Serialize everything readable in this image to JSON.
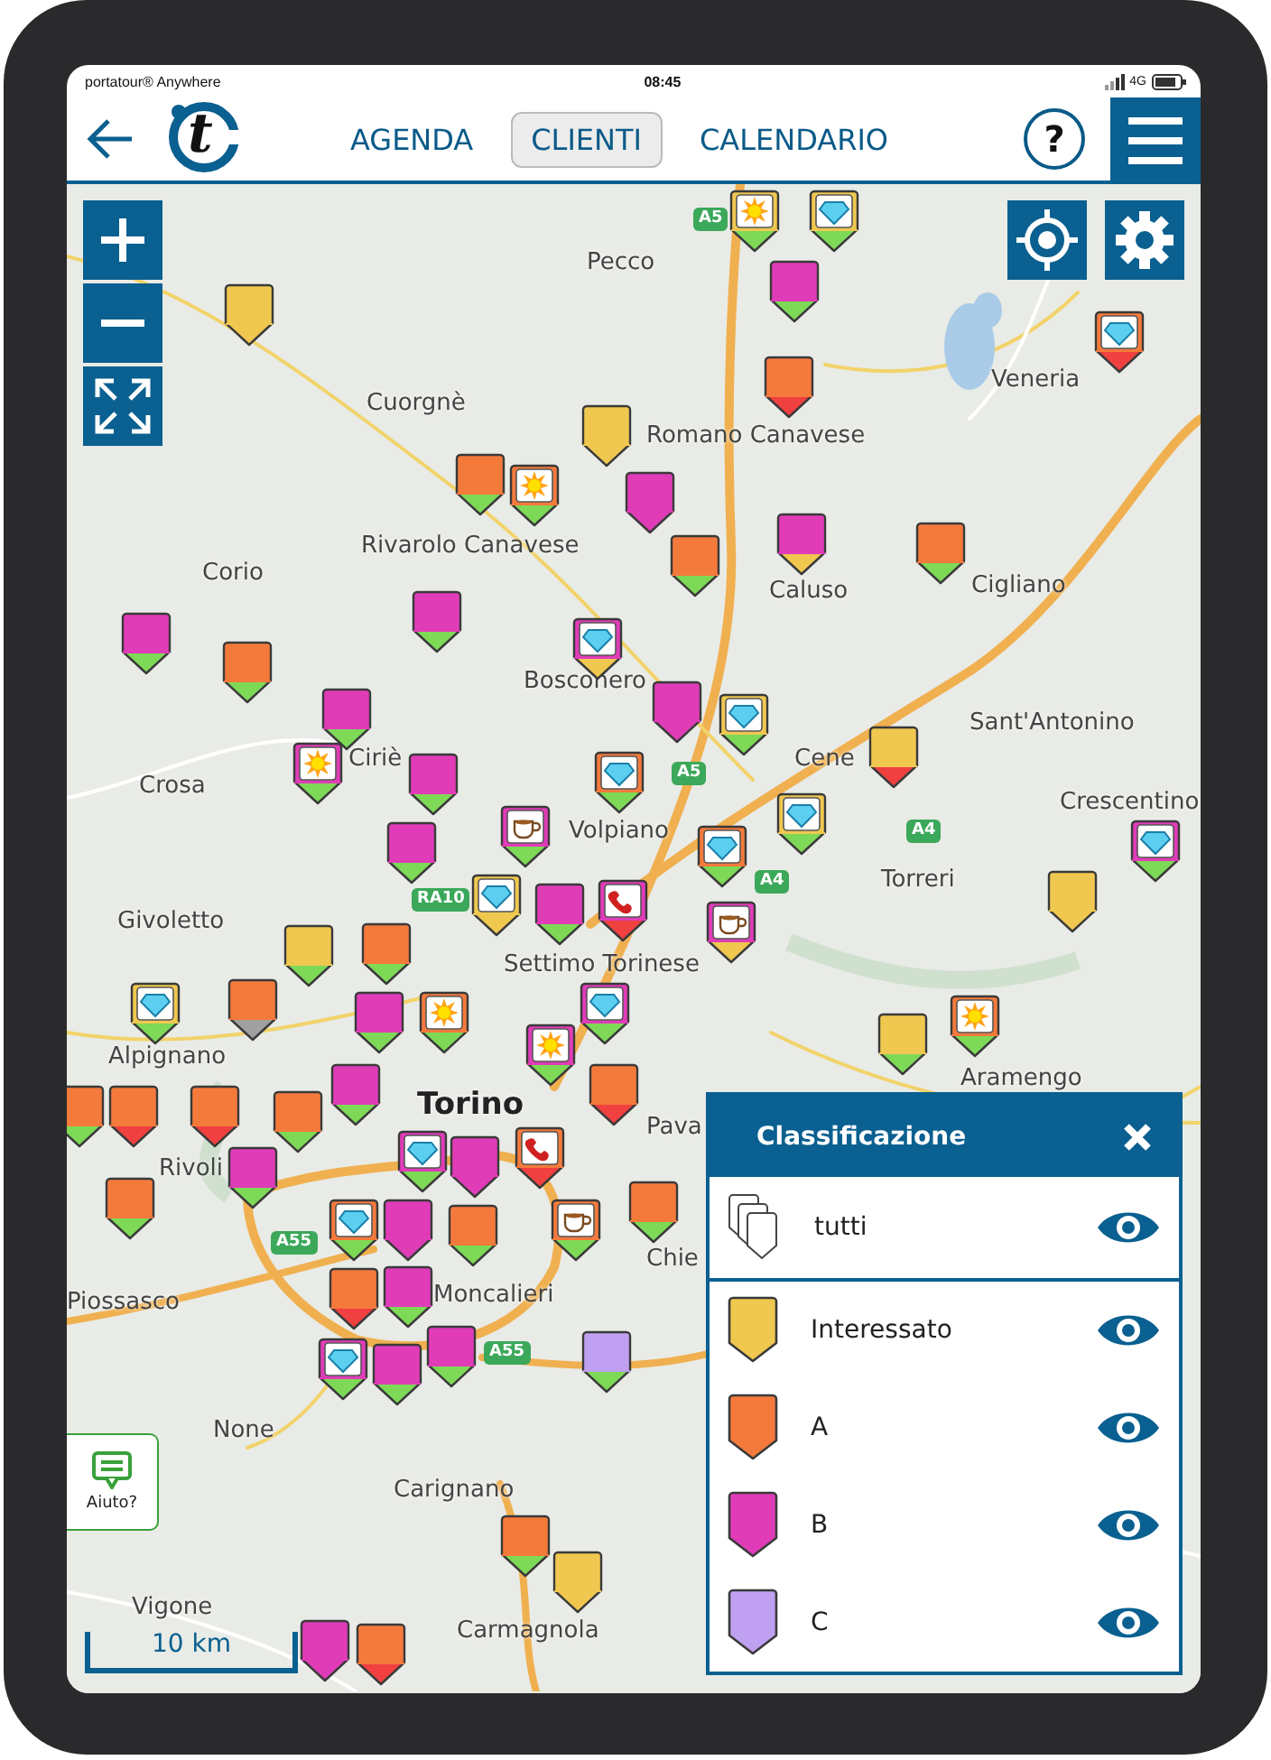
{
  "status_bar": {
    "app": "portatour® Anywhere",
    "time": "08:45",
    "network": "4G"
  },
  "header": {
    "logo_letter": "t",
    "tabs": [
      {
        "label": "AGENDA",
        "selected": false
      },
      {
        "label": "CLIENTI",
        "selected": true
      },
      {
        "label": "CALENDARIO",
        "selected": false
      }
    ],
    "help": "?"
  },
  "map": {
    "places": [
      {
        "name": "Pecco"
      },
      {
        "name": "Cuorgnè"
      },
      {
        "name": "Romano Canavese"
      },
      {
        "name": "Veneria"
      },
      {
        "name": "Rivarolo Canavese"
      },
      {
        "name": "Corio"
      },
      {
        "name": "Caluso"
      },
      {
        "name": "Cigliano"
      },
      {
        "name": "Bosconero"
      },
      {
        "name": "Sant'Antonino"
      },
      {
        "name": "Ciriè"
      },
      {
        "name": "Crosa"
      },
      {
        "name": "Cene"
      },
      {
        "name": "Volpiano"
      },
      {
        "name": "Crescentino"
      },
      {
        "name": "Givoletto"
      },
      {
        "name": "Torreri"
      },
      {
        "name": "Settimo Torinese"
      },
      {
        "name": "Alpignano"
      },
      {
        "name": "Torino",
        "kind": "city"
      },
      {
        "name": "Rivoli"
      },
      {
        "name": "Aramengo"
      },
      {
        "name": "Pava"
      },
      {
        "name": "Chie"
      },
      {
        "name": "Moncalieri"
      },
      {
        "name": "Piossasco"
      },
      {
        "name": "None"
      },
      {
        "name": "Carignano"
      },
      {
        "name": "Vigone"
      },
      {
        "name": "Carmagnola"
      }
    ],
    "roads": [
      {
        "label": "A5"
      },
      {
        "label": "A5"
      },
      {
        "label": "A4"
      },
      {
        "label": "A4"
      },
      {
        "label": "RA10"
      },
      {
        "label": "A55"
      },
      {
        "label": "A55"
      }
    ],
    "markers": [
      {
        "kind": "plain",
        "color": "#f0c850",
        "tail": {
          "color": "#f0c850"
        }
      },
      {
        "kind": "plain",
        "color": "#e03cb8",
        "tail": {
          "color": "#7ed957"
        }
      },
      {
        "kind": "sun",
        "color": "#f0c850",
        "tail": {
          "color": "#7ed957"
        }
      },
      {
        "kind": "diamond",
        "color": "#f0c850",
        "tail": {
          "color": "#7ed957"
        }
      },
      {
        "kind": "diamond",
        "color": "#f47a3c",
        "tail": {
          "color": "#f04040"
        }
      },
      {
        "kind": "plain",
        "color": "#f47a3c",
        "tail": {
          "color": "#f04040"
        }
      },
      {
        "kind": "plain",
        "color": "#f0c850",
        "tail": {
          "color": "#f0c850"
        }
      },
      {
        "kind": "plain",
        "color": "#f47a3c",
        "tail": {
          "color": "#7ed957"
        }
      },
      {
        "kind": "sun",
        "color": "#f47a3c",
        "tail": {
          "color": "#7ed957"
        }
      },
      {
        "kind": "plain",
        "color": "#e03cb8",
        "tail": {
          "color": "#e03cb8"
        }
      },
      {
        "kind": "plain",
        "color": "#f47a3c",
        "tail": {
          "color": "#7ed957"
        }
      },
      {
        "kind": "plain",
        "color": "#e03cb8",
        "tail": {
          "color": "#f0c850"
        }
      },
      {
        "kind": "plain",
        "color": "#f47a3c",
        "tail": {
          "color": "#7ed957"
        }
      },
      {
        "kind": "plain",
        "color": "#e03cb8",
        "tail": {
          "color": "#7ed957"
        }
      },
      {
        "kind": "plain",
        "color": "#e03cb8",
        "tail": {
          "color": "#7ed957"
        }
      },
      {
        "kind": "plain",
        "color": "#f47a3c",
        "tail": {
          "color": "#7ed957"
        }
      },
      {
        "kind": "diamond",
        "color": "#e03cb8",
        "tail": {
          "color": "#f0c850"
        }
      },
      {
        "kind": "plain",
        "color": "#e03cb8",
        "tail": {
          "color": "#7ed957"
        }
      },
      {
        "kind": "sun",
        "color": "#e03cb8",
        "tail": {
          "color": "#7ed957"
        }
      },
      {
        "kind": "diamond",
        "color": "#f0c850",
        "tail": {
          "color": "#7ed957"
        }
      },
      {
        "kind": "plain",
        "color": "#f0c850",
        "tail": {
          "color": "#f04040"
        }
      },
      {
        "kind": "plain",
        "color": "#e03cb8",
        "tail": {
          "color": "#e03cb8"
        }
      },
      {
        "kind": "diamond",
        "color": "#f47a3c",
        "tail": {
          "color": "#7ed957"
        }
      },
      {
        "kind": "plain",
        "color": "#e03cb8",
        "tail": {
          "color": "#7ed957"
        }
      },
      {
        "kind": "diamond",
        "color": "#e03cb8",
        "tail": {
          "color": "#7ed957"
        }
      },
      {
        "kind": "cup",
        "color": "#e03cb8",
        "tail": {
          "color": "#7ed957"
        }
      },
      {
        "kind": "plain",
        "color": "#e03cb8",
        "tail": {
          "color": "#7ed957"
        }
      },
      {
        "kind": "diamond",
        "color": "#f0c850",
        "tail": {
          "color": "#7ed957"
        }
      },
      {
        "kind": "diamond",
        "color": "#f47a3c",
        "tail": {
          "color": "#7ed957"
        }
      },
      {
        "kind": "diamond",
        "color": "#f0c850",
        "tail": {
          "color": "#f0c850"
        }
      },
      {
        "kind": "plain",
        "color": "#f0c850",
        "tail": {
          "color": "#f0c850"
        }
      },
      {
        "kind": "phone",
        "color": "#e03cb8",
        "tail": {
          "color": "#f04040"
        }
      },
      {
        "kind": "plain",
        "color": "#f0c850",
        "tail": {
          "color": "#7ed957"
        }
      },
      {
        "kind": "cup",
        "color": "#e03cb8",
        "tail": {
          "color": "#f0c850"
        }
      },
      {
        "kind": "plain",
        "color": "#f47a3c",
        "tail": {
          "color": "#7ed957"
        }
      },
      {
        "kind": "diamond",
        "color": "#f0c850",
        "tail": {
          "color": "#7ed957"
        }
      },
      {
        "kind": "plain",
        "color": "#f47a3c",
        "tail": {
          "color": "#a0a0a0"
        }
      },
      {
        "kind": "plain",
        "color": "#e03cb8",
        "tail": {
          "color": "#7ed957"
        }
      },
      {
        "kind": "diamond",
        "color": "#e03cb8",
        "tail": {
          "color": "#7ed957"
        }
      },
      {
        "kind": "plain",
        "color": "#e03cb8",
        "tail": {
          "color": "#7ed957"
        }
      },
      {
        "kind": "sun",
        "color": "#f47a3c",
        "tail": {
          "color": "#7ed957"
        }
      },
      {
        "kind": "sun",
        "color": "#e03cb8",
        "tail": {
          "color": "#7ed957"
        }
      },
      {
        "kind": "sun",
        "color": "#f47a3c",
        "tail": {
          "color": "#7ed957"
        }
      },
      {
        "kind": "plain",
        "color": "#f0c850",
        "tail": {
          "color": "#7ed957"
        }
      },
      {
        "kind": "plain",
        "color": "#f47a3c",
        "tail": {
          "color": "#7ed957"
        }
      },
      {
        "kind": "plain",
        "color": "#f47a3c",
        "tail": {
          "color": "#f04040"
        }
      },
      {
        "kind": "plain",
        "color": "#f47a3c",
        "tail": {
          "color": "#f04040"
        }
      },
      {
        "kind": "plain",
        "color": "#e03cb8",
        "tail": {
          "color": "#7ed957"
        }
      },
      {
        "kind": "plain",
        "color": "#f47a3c",
        "tail": {
          "color": "#7ed957"
        }
      },
      {
        "kind": "plain",
        "color": "#f47a3c",
        "tail": {
          "color": "#f04040"
        }
      },
      {
        "kind": "diamond",
        "color": "#e03cb8",
        "tail": {
          "color": "#7ed957"
        }
      },
      {
        "kind": "phone",
        "color": "#f47a3c",
        "tail": {
          "color": "#f04040"
        }
      },
      {
        "kind": "plain",
        "color": "#e03cb8",
        "tail": {
          "color": "#7ed957"
        }
      },
      {
        "kind": "plain",
        "color": "#e03cb8",
        "tail": {
          "color": "#e03cb8"
        }
      },
      {
        "kind": "plain",
        "color": "#f47a3c",
        "tail": {
          "color": "#7ed957"
        }
      },
      {
        "kind": "diamond",
        "color": "#f47a3c",
        "tail": {
          "color": "#7ed957"
        }
      },
      {
        "kind": "plain",
        "color": "#e03cb8",
        "tail": {
          "color": "#e03cb8"
        }
      },
      {
        "kind": "plain",
        "color": "#f47a3c",
        "tail": {
          "color": "#7ed957"
        }
      },
      {
        "kind": "cup",
        "color": "#f47a3c",
        "tail": {
          "color": "#7ed957"
        }
      },
      {
        "kind": "plain",
        "color": "#f47a3c",
        "tail": {
          "color": "#7ed957"
        }
      },
      {
        "kind": "plain",
        "color": "#f47a3c",
        "tail": {
          "color": "#f04040"
        }
      },
      {
        "kind": "plain",
        "color": "#e03cb8",
        "tail": {
          "color": "#7ed957"
        }
      },
      {
        "kind": "diamond",
        "color": "#e03cb8",
        "tail": {
          "color": "#7ed957"
        }
      },
      {
        "kind": "plain",
        "color": "#e03cb8",
        "tail": {
          "color": "#7ed957"
        }
      },
      {
        "kind": "plain",
        "color": "#e03cb8",
        "tail": {
          "color": "#7ed957"
        }
      },
      {
        "kind": "plain",
        "color": "#c0a0f0",
        "tail": {
          "color": "#7ed957"
        }
      },
      {
        "kind": "plain",
        "color": "#f47a3c",
        "tail": {
          "color": "#7ed957"
        }
      },
      {
        "kind": "plain",
        "color": "#f0c850",
        "tail": {
          "color": "#f0c850"
        }
      },
      {
        "kind": "plain",
        "color": "#f47a3c",
        "tail": {
          "color": "#f04040"
        }
      },
      {
        "kind": "plain",
        "color": "#e03cb8",
        "tail": {
          "color": "#e03cb8"
        }
      }
    ],
    "scale": "10 km",
    "help_widget": "Aiuto?"
  },
  "legend": {
    "title": "Classificazione",
    "items": [
      {
        "kind": "all",
        "label": "tutti",
        "visible": true
      },
      {
        "kind": "class",
        "label": "Interessato",
        "color": "#f0c850",
        "visible": true
      },
      {
        "kind": "class",
        "label": "A",
        "color": "#f47a3c",
        "visible": true
      },
      {
        "kind": "class",
        "label": "B",
        "color": "#e03cb8",
        "visible": true
      },
      {
        "kind": "class",
        "label": "C",
        "color": "#c0a0f0",
        "visible": true
      }
    ]
  }
}
